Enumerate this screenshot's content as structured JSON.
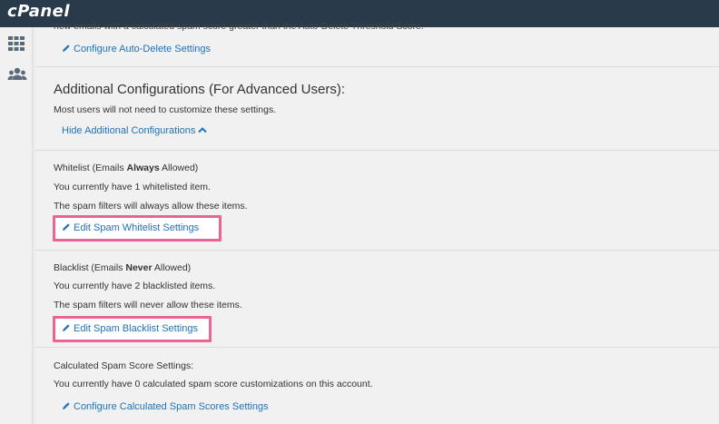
{
  "header": {
    "logo_text": "cPanel"
  },
  "sidebar": {
    "icons": [
      "grid-icon",
      "users-icon"
    ]
  },
  "auto_delete": {
    "clipped_text": "new emails with a calculated spam score greater than the Auto-Delete Threshold Score.",
    "link": "Configure Auto-Delete Settings"
  },
  "additional": {
    "heading": "Additional Configurations (For Advanced Users):",
    "description": "Most users will not need to customize these settings.",
    "toggle_link": "Hide Additional Configurations"
  },
  "whitelist": {
    "title_prefix": "Whitelist (Emails ",
    "title_bold": "Always",
    "title_suffix": " Allowed)",
    "count_text": "You currently have 1 whitelisted item.",
    "info_text": "The spam filters will always allow these items.",
    "link": "Edit Spam Whitelist Settings"
  },
  "blacklist": {
    "title_prefix": "Blacklist (Emails ",
    "title_bold": "Never",
    "title_suffix": " Allowed)",
    "count_text": "You currently have 2 blacklisted items.",
    "info_text": "The spam filters will never allow these items.",
    "link": "Edit Spam Blacklist Settings"
  },
  "spam_score": {
    "title": "Calculated Spam Score Settings:",
    "info_text": "You currently have 0 calculated spam score customizations on this account.",
    "link": "Configure Calculated Spam Scores Settings"
  },
  "colors": {
    "link": "#1f72b8",
    "highlight": "#ec6496",
    "topbar": "#293a4a"
  }
}
